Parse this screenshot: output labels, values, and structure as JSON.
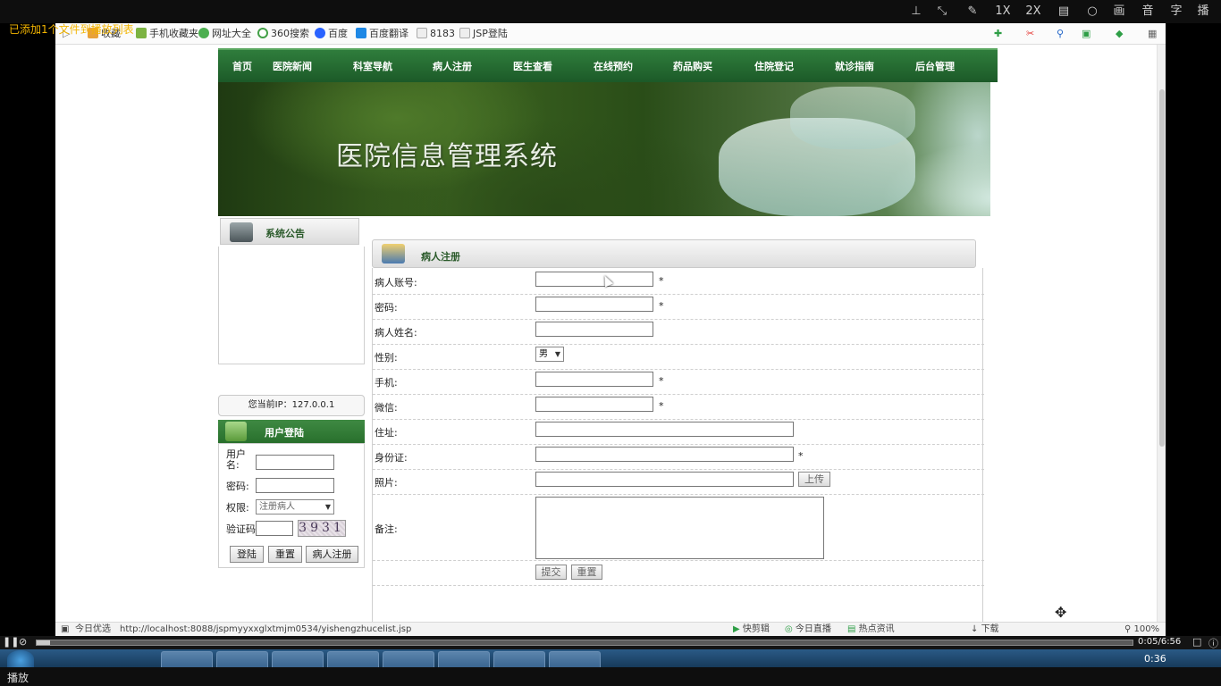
{
  "player": {
    "toast": "已添加1个文件到播放列表",
    "speed_1x": "1X",
    "speed_2x": "2X",
    "btn_picture": "画",
    "btn_audio": "音",
    "btn_subtitle": "字",
    "btn_cast": "播",
    "time": "0:05/6:56",
    "progress_fraction": 0.012,
    "play_label": "播放"
  },
  "taskbar": {
    "clock": "0:36"
  },
  "favorites": [
    {
      "label": "收藏",
      "color": "#e8a13a"
    },
    {
      "label": "手机收藏夹",
      "color": "#7cb342"
    },
    {
      "label": "网址大全",
      "color": "#4caf50"
    },
    {
      "label": "360搜索",
      "color": "#43a047"
    },
    {
      "label": "百度",
      "color": "#2962ff"
    },
    {
      "label": "百度翻译",
      "color": "#1e88e5"
    },
    {
      "label": "8183",
      "color": "#9e9e9e"
    },
    {
      "label": "JSP登陆",
      "color": "#9e9e9e"
    }
  ],
  "status": {
    "left_label": "今日优选",
    "url": "http://localhost:8088/jspmyyxxglxtmjm0534/yishengzhucelist.jsp",
    "items": [
      "快剪辑",
      "今日直播",
      "热点资讯",
      "下载"
    ],
    "zoom": "100%"
  },
  "nav": [
    "首页",
    "医院新闻",
    "科室导航",
    "病人注册",
    "医生查看",
    "在线预约",
    "药品购买",
    "住院登记",
    "就诊指南",
    "后台管理"
  ],
  "banner_title": "医院信息管理系统",
  "sidebar": {
    "notice_title": "系统公告",
    "ip_text": "您当前IP：127.0.0.1",
    "login_title": "用户登陆",
    "username_label": "用户名:",
    "password_label": "密码:",
    "role_label": "权限:",
    "role_value": "注册病人",
    "captcha_label": "验证码",
    "captcha_text": "3931",
    "login_btn": "登陆",
    "reset_btn": "重置",
    "register_btn": "病人注册"
  },
  "form": {
    "title": "病人注册",
    "account_label": "病人账号:",
    "password_label": "密码:",
    "name_label": "病人姓名:",
    "gender_label": "性别:",
    "gender_value": "男",
    "phone_label": "手机:",
    "wechat_label": "微信:",
    "address_label": "住址:",
    "idcard_label": "身份证:",
    "photo_label": "照片:",
    "upload_btn": "上传",
    "remark_label": "备注:",
    "required_mark": "*",
    "submit_btn": "提交",
    "reset_btn": "重置"
  }
}
